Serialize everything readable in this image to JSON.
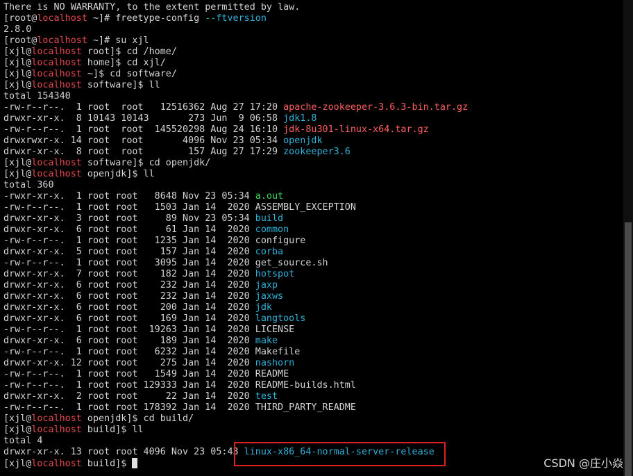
{
  "colors": {
    "background": "#000000",
    "default_text": "#d4d4d4",
    "prompt_host": "#e5484d",
    "directory": "#2eb1d6",
    "archive": "#ff5f5f",
    "executable": "#3ddc5c",
    "highlight_border": "#e02020"
  },
  "terminal": {
    "lines": [
      [
        {
          "t": "There is NO WARRANTY, to the extent permitted by law.",
          "c": "default"
        }
      ],
      [
        {
          "t": "[root@",
          "c": "default"
        },
        {
          "t": "localhost",
          "c": "host"
        },
        {
          "t": " ~]# freetype-config ",
          "c": "default"
        },
        {
          "t": "--ftversion",
          "c": "blue"
        }
      ],
      [
        {
          "t": "2.8.0",
          "c": "default"
        }
      ],
      [
        {
          "t": "[root@",
          "c": "default"
        },
        {
          "t": "localhost",
          "c": "host"
        },
        {
          "t": " ~]# su xjl",
          "c": "default"
        }
      ],
      [
        {
          "t": "[xjl@",
          "c": "default"
        },
        {
          "t": "localhost",
          "c": "host"
        },
        {
          "t": " root]$ cd /home/",
          "c": "default"
        }
      ],
      [
        {
          "t": "[xjl@",
          "c": "default"
        },
        {
          "t": "localhost",
          "c": "host"
        },
        {
          "t": " home]$ cd xjl/",
          "c": "default"
        }
      ],
      [
        {
          "t": "[xjl@",
          "c": "default"
        },
        {
          "t": "localhost",
          "c": "host"
        },
        {
          "t": " ~]$ cd software/",
          "c": "default"
        }
      ],
      [
        {
          "t": "[xjl@",
          "c": "default"
        },
        {
          "t": "localhost",
          "c": "host"
        },
        {
          "t": " software]$ ll",
          "c": "default"
        }
      ],
      [
        {
          "t": "total 154340",
          "c": "default"
        }
      ],
      [
        {
          "t": "-rw-r--r--.  1 root  root   12516362 Aug 27 17:20 ",
          "c": "default"
        },
        {
          "t": "apache-zookeeper-3.6.3-bin.tar.gz",
          "c": "red"
        }
      ],
      [
        {
          "t": "drwxr-xr-x.  8 10143 10143       273 Jun  9 06:58 ",
          "c": "default"
        },
        {
          "t": "jdk1.8",
          "c": "blue"
        }
      ],
      [
        {
          "t": "-rw-r--r--.  1 root  root  145520298 Aug 24 16:10 ",
          "c": "default"
        },
        {
          "t": "jdk-8u301-linux-x64.tar.gz",
          "c": "red"
        }
      ],
      [
        {
          "t": "drwxrwxr-x. 14 root  root       4096 Nov 23 05:34 ",
          "c": "default"
        },
        {
          "t": "openjdk",
          "c": "blue"
        }
      ],
      [
        {
          "t": "drwxr-xr-x.  8 root  root        157 Aug 27 17:29 ",
          "c": "default"
        },
        {
          "t": "zookeeper3.6",
          "c": "blue"
        }
      ],
      [
        {
          "t": "[xjl@",
          "c": "default"
        },
        {
          "t": "localhost",
          "c": "host"
        },
        {
          "t": " software]$ cd openjdk/",
          "c": "default"
        }
      ],
      [
        {
          "t": "[xjl@",
          "c": "default"
        },
        {
          "t": "localhost",
          "c": "host"
        },
        {
          "t": " openjdk]$ ll",
          "c": "default"
        }
      ],
      [
        {
          "t": "total 360",
          "c": "default"
        }
      ],
      [
        {
          "t": "-rwxr-xr-x.  1 root root   8648 Nov 23 05:34 ",
          "c": "default"
        },
        {
          "t": "a.out",
          "c": "green"
        }
      ],
      [
        {
          "t": "-rw-r--r--.  1 root root   1503 Jan 14  2020 ASSEMBLY_EXCEPTION",
          "c": "default"
        }
      ],
      [
        {
          "t": "drwxr-xr-x.  3 root root     89 Nov 23 05:34 ",
          "c": "default"
        },
        {
          "t": "build",
          "c": "blue"
        }
      ],
      [
        {
          "t": "drwxr-xr-x.  6 root root     61 Jan 14  2020 ",
          "c": "default"
        },
        {
          "t": "common",
          "c": "blue"
        }
      ],
      [
        {
          "t": "-rw-r--r--.  1 root root   1235 Jan 14  2020 configure",
          "c": "default"
        }
      ],
      [
        {
          "t": "drwxr-xr-x.  5 root root    157 Jan 14  2020 ",
          "c": "default"
        },
        {
          "t": "corba",
          "c": "blue"
        }
      ],
      [
        {
          "t": "-rw-r--r--.  1 root root   3095 Jan 14  2020 get_source.sh",
          "c": "default"
        }
      ],
      [
        {
          "t": "drwxr-xr-x.  7 root root    182 Jan 14  2020 ",
          "c": "default"
        },
        {
          "t": "hotspot",
          "c": "blue"
        }
      ],
      [
        {
          "t": "drwxr-xr-x.  6 root root    232 Jan 14  2020 ",
          "c": "default"
        },
        {
          "t": "jaxp",
          "c": "blue"
        }
      ],
      [
        {
          "t": "drwxr-xr-x.  6 root root    232 Jan 14  2020 ",
          "c": "default"
        },
        {
          "t": "jaxws",
          "c": "blue"
        }
      ],
      [
        {
          "t": "drwxr-xr-x.  6 root root    200 Jan 14  2020 ",
          "c": "default"
        },
        {
          "t": "jdk",
          "c": "blue"
        }
      ],
      [
        {
          "t": "drwxr-xr-x.  6 root root    169 Jan 14  2020 ",
          "c": "default"
        },
        {
          "t": "langtools",
          "c": "blue"
        }
      ],
      [
        {
          "t": "-rw-r--r--.  1 root root  19263 Jan 14  2020 LICENSE",
          "c": "default"
        }
      ],
      [
        {
          "t": "drwxr-xr-x.  6 root root    189 Jan 14  2020 ",
          "c": "default"
        },
        {
          "t": "make",
          "c": "blue"
        }
      ],
      [
        {
          "t": "-rw-r--r--.  1 root root   6232 Jan 14  2020 Makefile",
          "c": "default"
        }
      ],
      [
        {
          "t": "drwxr-xr-x. 12 root root    275 Jan 14  2020 ",
          "c": "default"
        },
        {
          "t": "nashorn",
          "c": "blue"
        }
      ],
      [
        {
          "t": "-rw-r--r--.  1 root root   1549 Jan 14  2020 README",
          "c": "default"
        }
      ],
      [
        {
          "t": "-rw-r--r--.  1 root root 129333 Jan 14  2020 README-builds.html",
          "c": "default"
        }
      ],
      [
        {
          "t": "drwxr-xr-x.  2 root root     22 Jan 14  2020 ",
          "c": "default"
        },
        {
          "t": "test",
          "c": "blue"
        }
      ],
      [
        {
          "t": "-rw-r--r--.  1 root root 178392 Jan 14  2020 THIRD_PARTY_README",
          "c": "default"
        }
      ],
      [
        {
          "t": "[xjl@",
          "c": "default"
        },
        {
          "t": "localhost",
          "c": "host"
        },
        {
          "t": " openjdk]$ cd build/",
          "c": "default"
        }
      ],
      [
        {
          "t": "[xjl@",
          "c": "default"
        },
        {
          "t": "localhost",
          "c": "host"
        },
        {
          "t": " build]$ ll",
          "c": "default"
        }
      ],
      [
        {
          "t": "total 4",
          "c": "default"
        }
      ],
      [
        {
          "t": "drwxr-xr-x. 13 root root 4096 Nov 23 05:43 ",
          "c": "default"
        },
        {
          "t": "linux-x86_64-normal-server-release",
          "c": "blue"
        }
      ],
      [
        {
          "t": "[xjl@",
          "c": "default"
        },
        {
          "t": "localhost",
          "c": "host"
        },
        {
          "t": " build]$ ",
          "c": "default"
        }
      ]
    ]
  },
  "watermark": {
    "text": "CSDN @庄小焱"
  }
}
